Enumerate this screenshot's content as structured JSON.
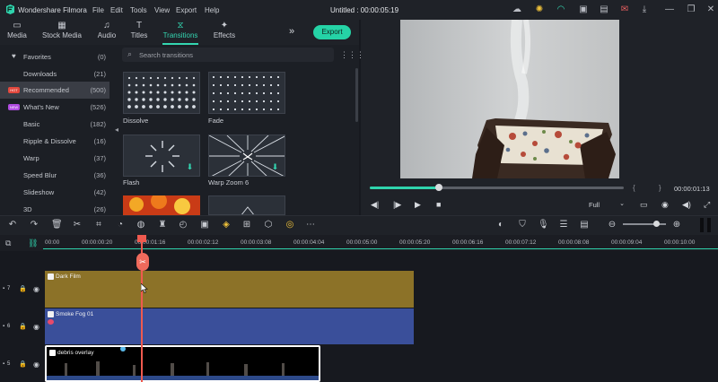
{
  "app": {
    "name": "Wondershare Filmora",
    "menu": [
      "File",
      "Edit",
      "Tools",
      "View",
      "Export",
      "Help"
    ],
    "doc_title": "Untitled : 00:00:05:19"
  },
  "tabs": [
    {
      "label": "Media",
      "icon": "media-icon"
    },
    {
      "label": "Stock Media",
      "icon": "stock-media-icon"
    },
    {
      "label": "Audio",
      "icon": "music-note-icon"
    },
    {
      "label": "Titles",
      "icon": "titles-icon"
    },
    {
      "label": "Transitions",
      "icon": "transitions-icon",
      "active": true
    },
    {
      "label": "Effects",
      "icon": "effects-icon"
    }
  ],
  "export_label": "Export",
  "sidebar": {
    "items": [
      {
        "label": "Favorites",
        "count": "(0)"
      },
      {
        "label": "Downloads",
        "count": "(21)"
      },
      {
        "label": "Recommended",
        "count": "(500)",
        "badge": "HOT",
        "selected": true
      },
      {
        "label": "What's New",
        "count": "(526)",
        "badge": "NEW"
      },
      {
        "label": "Basic",
        "count": "(182)"
      },
      {
        "label": "Ripple & Dissolve",
        "count": "(16)"
      },
      {
        "label": "Warp",
        "count": "(37)"
      },
      {
        "label": "Speed Blur",
        "count": "(36)"
      },
      {
        "label": "Slideshow",
        "count": "(42)"
      },
      {
        "label": "3D",
        "count": "(26)"
      }
    ]
  },
  "search": {
    "placeholder": "Search transitions"
  },
  "gallery": {
    "items": [
      {
        "label": "Dissolve"
      },
      {
        "label": "Fade"
      },
      {
        "label": "Flash"
      },
      {
        "label": "Warp Zoom 6"
      }
    ]
  },
  "player": {
    "timecode": "00:00:01:13",
    "brackets": "{ }",
    "quality": "Full",
    "progress": 0.27
  },
  "ruler": {
    "labels": [
      "00:00",
      "00:00:00:20",
      "00:00:01:16",
      "00:00:02:12",
      "00:00:03:08",
      "00:00:04:04",
      "00:00:05:00",
      "00:00:05:20",
      "00:00:06:16",
      "00:00:07:12",
      "00:00:08:08",
      "00:00:09:04",
      "00:00:10:00"
    ]
  },
  "tracks": [
    {
      "number": "7",
      "clip": "Dark Film",
      "color": "#8c7228"
    },
    {
      "number": "6",
      "clip": "Smoke Fog 01",
      "color": "#3a4f9a"
    },
    {
      "number": "5",
      "clip": "debris overlay",
      "color": "#000000"
    }
  ],
  "colors": {
    "accent": "#2fd4ad",
    "playhead": "#ef5a4f"
  }
}
